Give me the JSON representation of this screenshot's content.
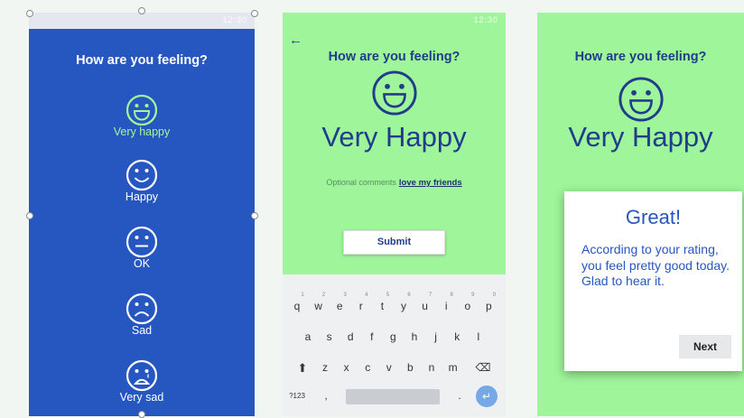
{
  "screen1": {
    "title": "How are you feeling?",
    "status_time": "12:30",
    "moods": [
      {
        "icon": "very-happy-face-icon",
        "label": "Very happy",
        "selected": true
      },
      {
        "icon": "happy-face-icon",
        "label": "Happy",
        "selected": false
      },
      {
        "icon": "neutral-face-icon",
        "label": "OK",
        "selected": false
      },
      {
        "icon": "sad-face-icon",
        "label": "Sad",
        "selected": false
      },
      {
        "icon": "very-sad-face-icon",
        "label": "Very sad",
        "selected": false
      }
    ],
    "colors": {
      "background": "#2657c1",
      "selected": "#a6f59b",
      "label": "#ffffff"
    }
  },
  "screen2": {
    "title": "How are you feeling?",
    "status_time": "12:30",
    "mood_text": "Very Happy",
    "comment_label": "Optional comments",
    "comment_value": "love my friends",
    "submit_label": "Submit",
    "keyboard": {
      "row1": [
        "q",
        "w",
        "e",
        "r",
        "t",
        "y",
        "u",
        "i",
        "o",
        "p"
      ],
      "row1_hints": [
        "1",
        "2",
        "3",
        "4",
        "5",
        "6",
        "7",
        "8",
        "9",
        "0"
      ],
      "row2": [
        "a",
        "s",
        "d",
        "f",
        "g",
        "h",
        "j",
        "k",
        "l"
      ],
      "row3": [
        "z",
        "x",
        "c",
        "v",
        "b",
        "n",
        "m"
      ],
      "symbols_key": "?123",
      "comma_key": ",",
      "period_key": "."
    },
    "colors": {
      "background": "#9ef59a",
      "text": "#203c8a"
    }
  },
  "screen3": {
    "title": "How are you feeling?",
    "mood_text": "Very Happy",
    "dialog_title": "Great!",
    "dialog_body": "According to your rating, you feel pretty good today. Glad to hear it.",
    "next_label": "Next",
    "colors": {
      "background": "#9ef59a",
      "dialog_text": "#2657c1"
    }
  }
}
